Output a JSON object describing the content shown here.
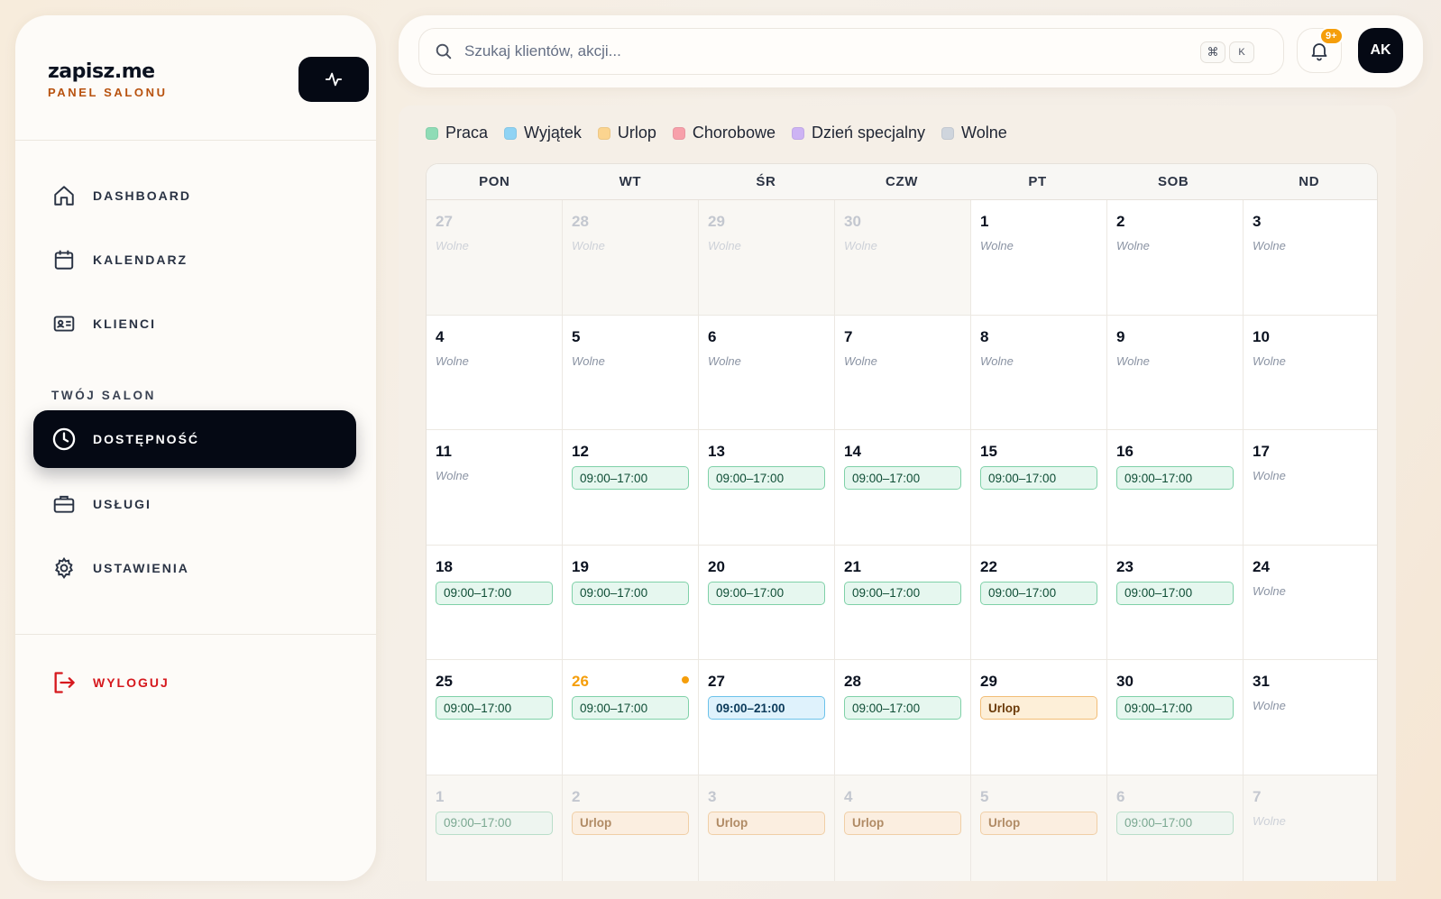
{
  "brand": {
    "name": "zapisz.me",
    "subtitle": "PANEL SALONU"
  },
  "nav": {
    "dashboard": "DASHBOARD",
    "calendar": "KALENDARZ",
    "clients": "KLIENCI",
    "section_title": "TWÓJ SALON",
    "availability": "DOSTĘPNOŚĆ",
    "services": "USŁUGI",
    "settings": "USTAWIENIA",
    "logout": "WYLOGUJ"
  },
  "search": {
    "placeholder": "Szukaj klientów, akcji...",
    "shortcut_cmd": "⌘",
    "shortcut_key": "K"
  },
  "notifications": {
    "badge": "9+"
  },
  "user": {
    "initials": "AK"
  },
  "legend": [
    {
      "label": "Praca",
      "color": "#8fdcb6"
    },
    {
      "label": "Wyjątek",
      "color": "#8fd3f4"
    },
    {
      "label": "Urlop",
      "color": "#fbd48f"
    },
    {
      "label": "Chorobowe",
      "color": "#f7a0aa"
    },
    {
      "label": "Dzień specjalny",
      "color": "#cdb3f4"
    },
    {
      "label": "Wolne",
      "color": "#cfd5dd"
    }
  ],
  "weekdays": [
    "PON",
    "WT",
    "ŚR",
    "CZW",
    "PT",
    "SOB",
    "ND"
  ],
  "days": [
    {
      "day": "27",
      "out": true,
      "type": "wolne",
      "label": "Wolne"
    },
    {
      "day": "28",
      "out": true,
      "type": "wolne",
      "label": "Wolne"
    },
    {
      "day": "29",
      "out": true,
      "type": "wolne",
      "label": "Wolne"
    },
    {
      "day": "30",
      "out": true,
      "type": "wolne",
      "label": "Wolne"
    },
    {
      "day": "1",
      "type": "wolne",
      "label": "Wolne"
    },
    {
      "day": "2",
      "type": "wolne",
      "label": "Wolne"
    },
    {
      "day": "3",
      "type": "wolne",
      "label": "Wolne"
    },
    {
      "day": "4",
      "type": "wolne",
      "label": "Wolne"
    },
    {
      "day": "5",
      "type": "wolne",
      "label": "Wolne"
    },
    {
      "day": "6",
      "type": "wolne",
      "label": "Wolne"
    },
    {
      "day": "7",
      "type": "wolne",
      "label": "Wolne"
    },
    {
      "day": "8",
      "type": "wolne",
      "label": "Wolne"
    },
    {
      "day": "9",
      "type": "wolne",
      "label": "Wolne"
    },
    {
      "day": "10",
      "type": "wolne",
      "label": "Wolne"
    },
    {
      "day": "11",
      "type": "wolne",
      "label": "Wolne"
    },
    {
      "day": "12",
      "type": "work",
      "label": "09:00–17:00"
    },
    {
      "day": "13",
      "type": "work",
      "label": "09:00–17:00"
    },
    {
      "day": "14",
      "type": "work",
      "label": "09:00–17:00"
    },
    {
      "day": "15",
      "type": "work",
      "label": "09:00–17:00"
    },
    {
      "day": "16",
      "type": "work",
      "label": "09:00–17:00"
    },
    {
      "day": "17",
      "type": "wolne",
      "label": "Wolne"
    },
    {
      "day": "18",
      "type": "work",
      "label": "09:00–17:00"
    },
    {
      "day": "19",
      "type": "work",
      "label": "09:00–17:00"
    },
    {
      "day": "20",
      "type": "work",
      "label": "09:00–17:00"
    },
    {
      "day": "21",
      "type": "work",
      "label": "09:00–17:00"
    },
    {
      "day": "22",
      "type": "work",
      "label": "09:00–17:00"
    },
    {
      "day": "23",
      "type": "work",
      "label": "09:00–17:00"
    },
    {
      "day": "24",
      "type": "wolne",
      "label": "Wolne"
    },
    {
      "day": "25",
      "type": "work",
      "label": "09:00–17:00"
    },
    {
      "day": "26",
      "type": "work",
      "label": "09:00–17:00",
      "today": true
    },
    {
      "day": "27",
      "type": "exc",
      "label": "09:00–21:00"
    },
    {
      "day": "28",
      "type": "work",
      "label": "09:00–17:00"
    },
    {
      "day": "29",
      "type": "vac",
      "label": "Urlop"
    },
    {
      "day": "30",
      "type": "work",
      "label": "09:00–17:00"
    },
    {
      "day": "31",
      "type": "wolne",
      "label": "Wolne"
    },
    {
      "day": "1",
      "out": true,
      "type": "work",
      "label": "09:00–17:00"
    },
    {
      "day": "2",
      "out": true,
      "type": "vac",
      "label": "Urlop"
    },
    {
      "day": "3",
      "out": true,
      "type": "vac",
      "label": "Urlop"
    },
    {
      "day": "4",
      "out": true,
      "type": "vac",
      "label": "Urlop"
    },
    {
      "day": "5",
      "out": true,
      "type": "vac",
      "label": "Urlop"
    },
    {
      "day": "6",
      "out": true,
      "type": "work",
      "label": "09:00–17:00"
    },
    {
      "day": "7",
      "out": true,
      "type": "wolne",
      "label": "Wolne"
    }
  ]
}
